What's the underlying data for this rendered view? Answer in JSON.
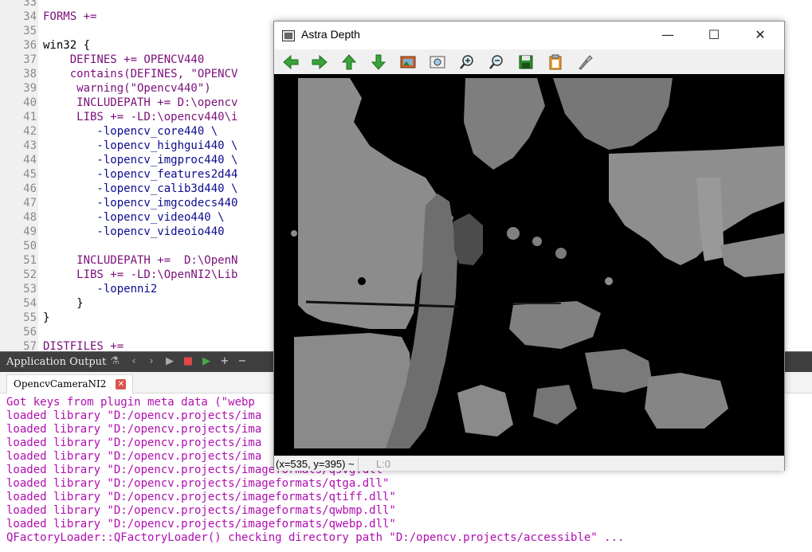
{
  "editor": {
    "lines": [
      {
        "num": "33",
        "text": ""
      },
      {
        "num": "34",
        "text": "FORMS +="
      },
      {
        "num": "35",
        "text": ""
      },
      {
        "num": "36",
        "text": "win32 {"
      },
      {
        "num": "37",
        "text": "    DEFINES += OPENCV440"
      },
      {
        "num": "38",
        "text": "    contains(DEFINES, \"OPENCV"
      },
      {
        "num": "39",
        "text": "     warning(\"Opencv440\")"
      },
      {
        "num": "40",
        "text": "     INCLUDEPATH += D:\\opencv"
      },
      {
        "num": "41",
        "text": "     LIBS += -LD:\\opencv440\\i"
      },
      {
        "num": "42",
        "text": "        -lopencv_core440 \\"
      },
      {
        "num": "43",
        "text": "        -lopencv_highgui440 \\"
      },
      {
        "num": "44",
        "text": "        -lopencv_imgproc440 \\"
      },
      {
        "num": "45",
        "text": "        -lopencv_features2d44"
      },
      {
        "num": "46",
        "text": "        -lopencv_calib3d440 \\"
      },
      {
        "num": "47",
        "text": "        -lopencv_imgcodecs440"
      },
      {
        "num": "48",
        "text": "        -lopencv_video440 \\"
      },
      {
        "num": "49",
        "text": "        -lopencv_videoio440"
      },
      {
        "num": "50",
        "text": ""
      },
      {
        "num": "51",
        "text": "     INCLUDEPATH +=  D:\\OpenN"
      },
      {
        "num": "52",
        "text": "     LIBS += -LD:\\OpenNI2\\Lib"
      },
      {
        "num": "53",
        "text": "        -lopenni2"
      },
      {
        "num": "54",
        "text": "     }"
      },
      {
        "num": "55",
        "text": "}"
      },
      {
        "num": "56",
        "text": ""
      },
      {
        "num": "57",
        "text": "DISTFILES +="
      }
    ]
  },
  "output_pane": {
    "title": "Application Output",
    "tab_label": "OpencvCameraNI2",
    "tab_close": "✕",
    "lines": [
      "Got keys from plugin meta data (\"webp",
      "loaded library \"D:/opencv.projects/ima",
      "loaded library \"D:/opencv.projects/ima",
      "loaded library \"D:/opencv.projects/ima",
      "loaded library \"D:/opencv.projects/ima",
      "loaded library \"D:/opencv.projects/imageformats/qsvg.dll\"",
      "loaded library \"D:/opencv.projects/imageformats/qtga.dll\"",
      "loaded library \"D:/opencv.projects/imageformats/qtiff.dll\"",
      "loaded library \"D:/opencv.projects/imageformats/qwbmp.dll\"",
      "loaded library \"D:/opencv.projects/imageformats/qwebp.dll\"",
      "QFactoryLoader::QFactoryLoader() checking directory path \"D:/opencv.projects/accessible\" ..."
    ]
  },
  "window": {
    "title": "Astra Depth",
    "minimize": "—",
    "maximize": "☐",
    "close": "✕",
    "status": "(x=535, y=395) ~",
    "status_level": "L:0"
  },
  "colors": {
    "arrow_green": "#3aa23a",
    "depth_light": "#8c8c8c",
    "depth_mid": "#6e6e6e",
    "depth_dark": "#4c4c4c",
    "output_text": "#b00db0",
    "keyword": "#7a0f7a"
  },
  "toolbar_icons": [
    "arrow-left-icon",
    "arrow-right-icon",
    "arrow-up-icon",
    "arrow-down-icon",
    "image-icon",
    "zoom-fit-icon",
    "zoom-in-icon",
    "zoom-out-icon",
    "save-icon",
    "copy-icon",
    "properties-icon"
  ]
}
